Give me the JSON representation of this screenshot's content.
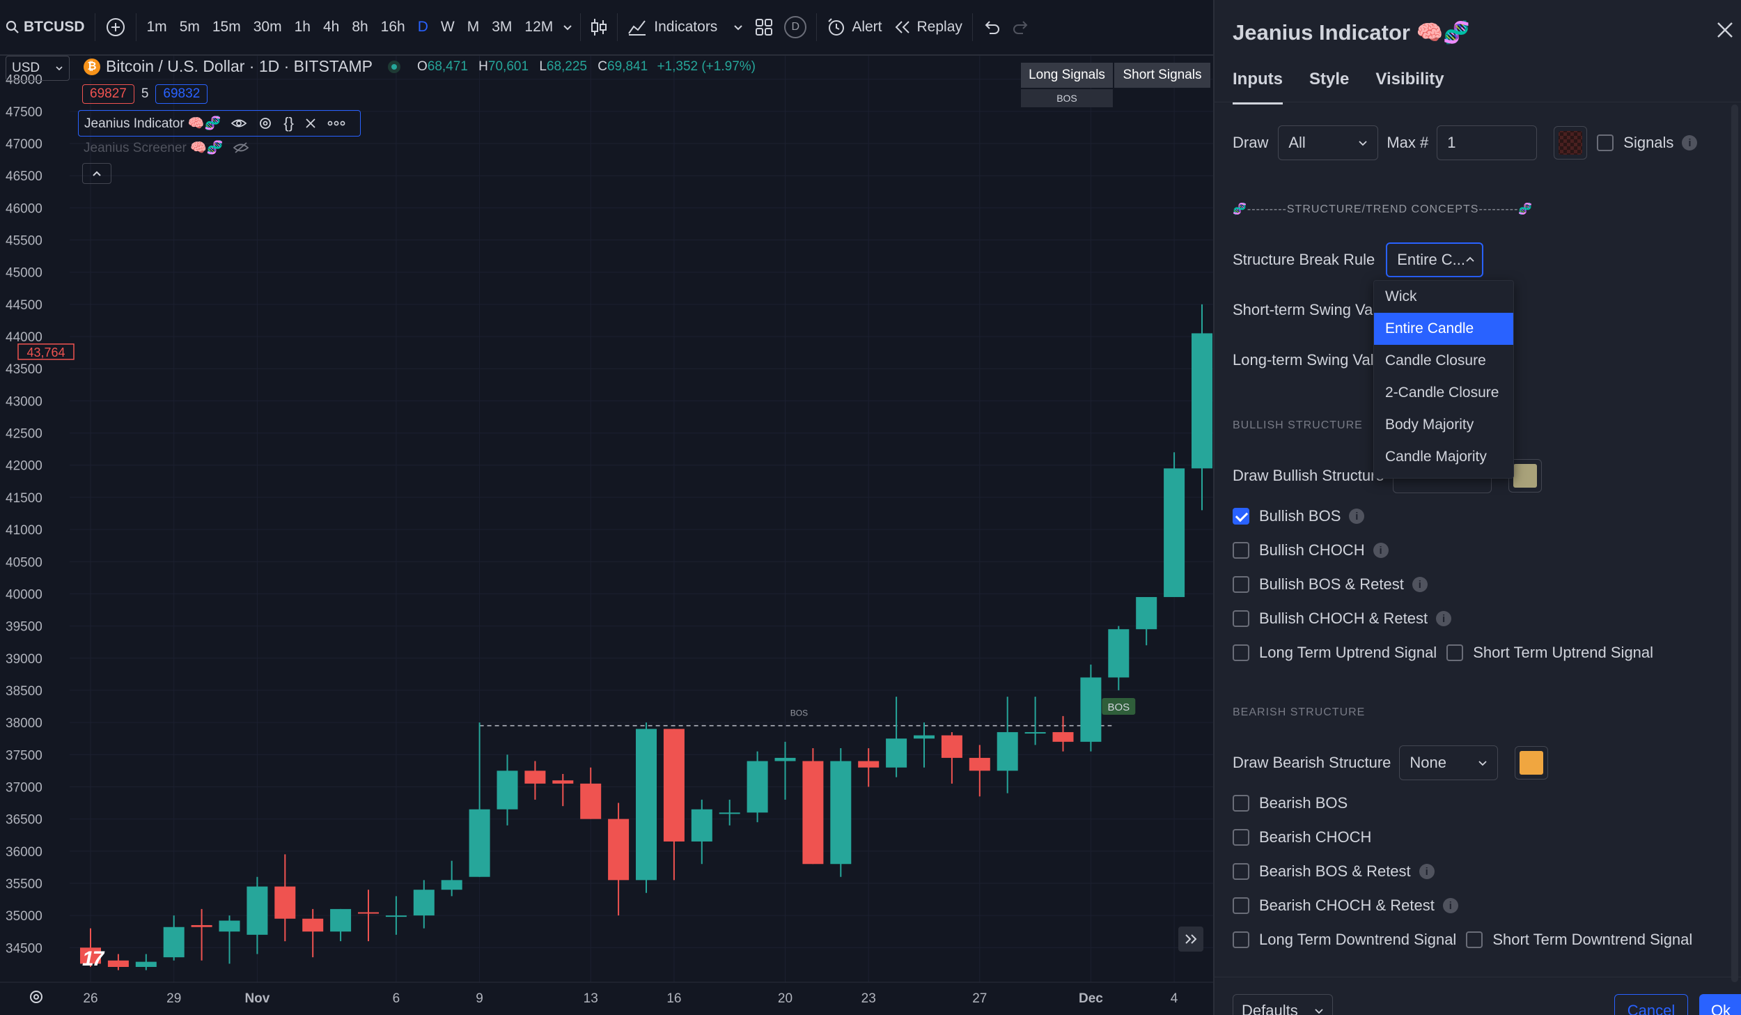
{
  "toolbar": {
    "symbol": "BTCUSD",
    "intervals": [
      "1m",
      "5m",
      "15m",
      "30m",
      "1h",
      "4h",
      "8h",
      "16h",
      "D",
      "W",
      "M",
      "3M",
      "12M"
    ],
    "active_interval": "D",
    "indicators_label": "Indicators",
    "d_badge": "D",
    "alert_label": "Alert",
    "replay_label": "Replay"
  },
  "legend": {
    "currency": "USD",
    "title": "Bitcoin / U.S. Dollar · 1D · BITSTAMP",
    "o_label": "O",
    "o_value": "68,471",
    "h_label": "H",
    "h_value": "70,601",
    "l_label": "L",
    "l_value": "68,225",
    "c_label": "C",
    "c_value": "69,841",
    "change": "+1,352 (+1.97%)",
    "bid": "69827",
    "spread": "5",
    "ask": "69832",
    "indicator1": "Jeanius Indicator 🧠🧬",
    "indicator2": "Jeanius Screener 🧠🧬"
  },
  "signals_table": {
    "long_header": "Long Signals",
    "short_header": "Short Signals",
    "long_value": "BOS",
    "short_value": ""
  },
  "chart_data": {
    "type": "candlestick",
    "title": "Bitcoin / U.S. Dollar · 1D · BITSTAMP",
    "y_ticks": [
      48000,
      47500,
      47000,
      46500,
      46000,
      45500,
      45000,
      44500,
      44000,
      43500,
      43000,
      42500,
      42000,
      41500,
      41000,
      40500,
      40000,
      39500,
      39000,
      38500,
      38000,
      37500,
      37000,
      36500,
      36000,
      35500,
      35000,
      34500
    ],
    "ylim": [
      34200,
      48300
    ],
    "x_labels": [
      {
        "label": "26",
        "index": 0
      },
      {
        "label": "29",
        "index": 3
      },
      {
        "label": "Nov",
        "index": 6
      },
      {
        "label": "6",
        "index": 11
      },
      {
        "label": "9",
        "index": 14
      },
      {
        "label": "13",
        "index": 18
      },
      {
        "label": "16",
        "index": 21
      },
      {
        "label": "20",
        "index": 25
      },
      {
        "label": "23",
        "index": 28
      },
      {
        "label": "27",
        "index": 32
      },
      {
        "label": "Dec",
        "index": 36
      },
      {
        "label": "4",
        "index": 39
      }
    ],
    "candles": [
      {
        "o": 34500,
        "h": 34800,
        "l": 34200,
        "c": 34250
      },
      {
        "o": 34300,
        "h": 34400,
        "l": 34150,
        "c": 34200
      },
      {
        "o": 34200,
        "h": 34400,
        "l": 34150,
        "c": 34280
      },
      {
        "o": 34350,
        "h": 35000,
        "l": 34300,
        "c": 34820
      },
      {
        "o": 34850,
        "h": 35100,
        "l": 34300,
        "c": 34820
      },
      {
        "o": 34750,
        "h": 35000,
        "l": 34250,
        "c": 34920
      },
      {
        "o": 34700,
        "h": 35600,
        "l": 34400,
        "c": 35450
      },
      {
        "o": 35450,
        "h": 35950,
        "l": 34600,
        "c": 34950
      },
      {
        "o": 34950,
        "h": 35100,
        "l": 34350,
        "c": 34750
      },
      {
        "o": 34750,
        "h": 35100,
        "l": 34600,
        "c": 35100
      },
      {
        "o": 35050,
        "h": 35400,
        "l": 34600,
        "c": 35030
      },
      {
        "o": 35000,
        "h": 35300,
        "l": 34700,
        "c": 35000
      },
      {
        "o": 35000,
        "h": 35550,
        "l": 34800,
        "c": 35400
      },
      {
        "o": 35400,
        "h": 35850,
        "l": 35300,
        "c": 35550
      },
      {
        "o": 35600,
        "h": 38000,
        "l": 35600,
        "c": 36650
      },
      {
        "o": 36650,
        "h": 37500,
        "l": 36400,
        "c": 37250
      },
      {
        "o": 37250,
        "h": 37400,
        "l": 36800,
        "c": 37050
      },
      {
        "o": 37100,
        "h": 37200,
        "l": 36700,
        "c": 37050
      },
      {
        "o": 37050,
        "h": 37300,
        "l": 36500,
        "c": 36500
      },
      {
        "o": 36500,
        "h": 36750,
        "l": 35000,
        "c": 35550
      },
      {
        "o": 35550,
        "h": 38000,
        "l": 35350,
        "c": 37900
      },
      {
        "o": 37900,
        "h": 37900,
        "l": 35550,
        "c": 36150
      },
      {
        "o": 36150,
        "h": 36800,
        "l": 35800,
        "c": 36650
      },
      {
        "o": 36600,
        "h": 36800,
        "l": 36400,
        "c": 36600
      },
      {
        "o": 36600,
        "h": 37550,
        "l": 36450,
        "c": 37400
      },
      {
        "o": 37400,
        "h": 37700,
        "l": 36800,
        "c": 37450
      },
      {
        "o": 37400,
        "h": 37600,
        "l": 35800,
        "c": 35800
      },
      {
        "o": 35800,
        "h": 37600,
        "l": 35600,
        "c": 37400
      },
      {
        "o": 37400,
        "h": 37600,
        "l": 37000,
        "c": 37300
      },
      {
        "o": 37300,
        "h": 38400,
        "l": 37150,
        "c": 37750
      },
      {
        "o": 37750,
        "h": 38000,
        "l": 37300,
        "c": 37800
      },
      {
        "o": 37800,
        "h": 37850,
        "l": 37050,
        "c": 37450
      },
      {
        "o": 37450,
        "h": 37650,
        "l": 36850,
        "c": 37250
      },
      {
        "o": 37250,
        "h": 38400,
        "l": 36900,
        "c": 37850
      },
      {
        "o": 37850,
        "h": 38400,
        "l": 37650,
        "c": 37850
      },
      {
        "o": 37850,
        "h": 38100,
        "l": 37550,
        "c": 37700
      },
      {
        "o": 37700,
        "h": 38900,
        "l": 37550,
        "c": 38700
      },
      {
        "o": 38700,
        "h": 39500,
        "l": 38500,
        "c": 39450
      },
      {
        "o": 39450,
        "h": 39800,
        "l": 39200,
        "c": 39950
      },
      {
        "o": 39950,
        "h": 42200,
        "l": 39950,
        "c": 41950
      },
      {
        "o": 41950,
        "h": 44500,
        "l": 41300,
        "c": 44050
      }
    ],
    "bos_level": 37950,
    "bos_label": "BOS",
    "bos_badge": "BOS",
    "price_marker": "43,764",
    "up_color": "#26a69a",
    "down_color": "#ef5350"
  },
  "panel": {
    "title": "Jeanius Indicator 🧠🧬",
    "tabs": [
      "Inputs",
      "Style",
      "Visibility"
    ],
    "draw_label": "Draw",
    "draw_value": "All",
    "max_label": "Max #",
    "max_value": "1",
    "signals_label": "Signals",
    "divider": "🧬---------STRUCTURE/TREND CONCEPTS---------🧬",
    "structure_break_label": "Structure Break Rule",
    "structure_break_value": "Entire C...",
    "short_swing_label": "Short-term Swing Valu",
    "long_swing_label": "Long-term Swing Valu",
    "dropdown_options": [
      "Wick",
      "Entire Candle",
      "Candle Closure",
      "2-Candle Closure",
      "Body Majority",
      "Candle Majority"
    ],
    "dropdown_selected": "Entire Candle",
    "bullish_section": "BULLISH STRUCTURE",
    "draw_bullish_label": "Draw Bullish Structure",
    "bullish_checks": [
      "Bullish BOS",
      "Bullish CHOCH",
      "Bullish BOS & Retest",
      "Bullish CHOCH & Retest"
    ],
    "long_up_label": "Long Term Uptrend Signal",
    "short_up_label": "Short Term Uptrend Signal",
    "bearish_section": "BEARISH STRUCTURE",
    "draw_bearish_label": "Draw Bearish Structure",
    "draw_bearish_value": "None",
    "bearish_checks": [
      "Bearish BOS",
      "Bearish CHOCH",
      "Bearish BOS & Retest",
      "Bearish CHOCH & Retest"
    ],
    "long_down_label": "Long Term Downtrend Signal",
    "short_down_label": "Short Term Downtrend Signal",
    "defaults_label": "Defaults",
    "cancel_label": "Cancel",
    "ok_label": "Ok",
    "bullish_color": "#a9a27a",
    "bearish_color": "#f0a640"
  }
}
